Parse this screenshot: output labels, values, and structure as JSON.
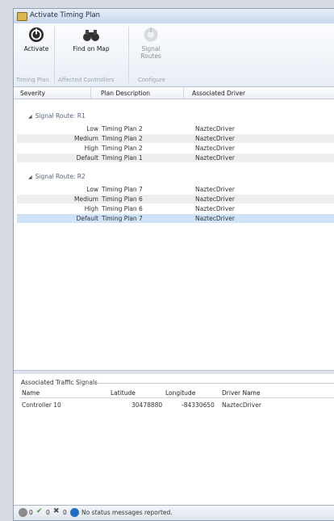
{
  "window": {
    "title": "Activate Timing Plan"
  },
  "ribbon": {
    "buttons": [
      {
        "label": "Activate",
        "icon": "power-icon",
        "enabled": true
      },
      {
        "label": "Find on Map",
        "icon": "binoculars-icon",
        "enabled": true
      },
      {
        "label": "Signal Routes",
        "icon": "signal-routes-icon",
        "enabled": false
      }
    ],
    "groups": [
      "Timing Plan",
      "Affected Controllers",
      "Configure"
    ]
  },
  "grid": {
    "columns": [
      "Severity",
      "Plan Description",
      "Associated Driver"
    ],
    "groups": [
      {
        "label": "Signal Route: R1",
        "rows": [
          {
            "severity": "Low",
            "plan": "Timing Plan 2",
            "driver": "NaztecDriver"
          },
          {
            "severity": "Medium",
            "plan": "Timing Plan 2",
            "driver": "NaztecDriver"
          },
          {
            "severity": "High",
            "plan": "Timing Plan 2",
            "driver": "NaztecDriver"
          },
          {
            "severity": "Default",
            "plan": "Timing Plan 1",
            "driver": "NaztecDriver"
          }
        ]
      },
      {
        "label": "Signal Route: R2",
        "rows": [
          {
            "severity": "Low",
            "plan": "Timing Plan 7",
            "driver": "NaztecDriver"
          },
          {
            "severity": "Medium",
            "plan": "Timing Plan 6",
            "driver": "NaztecDriver"
          },
          {
            "severity": "High",
            "plan": "Timing Plan 6",
            "driver": "NaztecDriver"
          },
          {
            "severity": "Default",
            "plan": "Timing Plan 7",
            "driver": "NaztecDriver"
          }
        ]
      }
    ]
  },
  "signals": {
    "title": "Associated Traffic Signals",
    "columns": [
      "Name",
      "Latitude",
      "Longitude",
      "Driver Name"
    ],
    "rows": [
      {
        "name": "Controller 10",
        "latitude": "30478880",
        "longitude": "-84330650",
        "driver": "NaztecDriver"
      }
    ]
  },
  "status": {
    "errors": "0",
    "ok": "0",
    "warnings": "0",
    "message": "No status messages reported."
  },
  "colors": {
    "accent": "#1f6fc5",
    "selected_row": "#cfe3f8",
    "alt_row": "#eeeeee"
  }
}
